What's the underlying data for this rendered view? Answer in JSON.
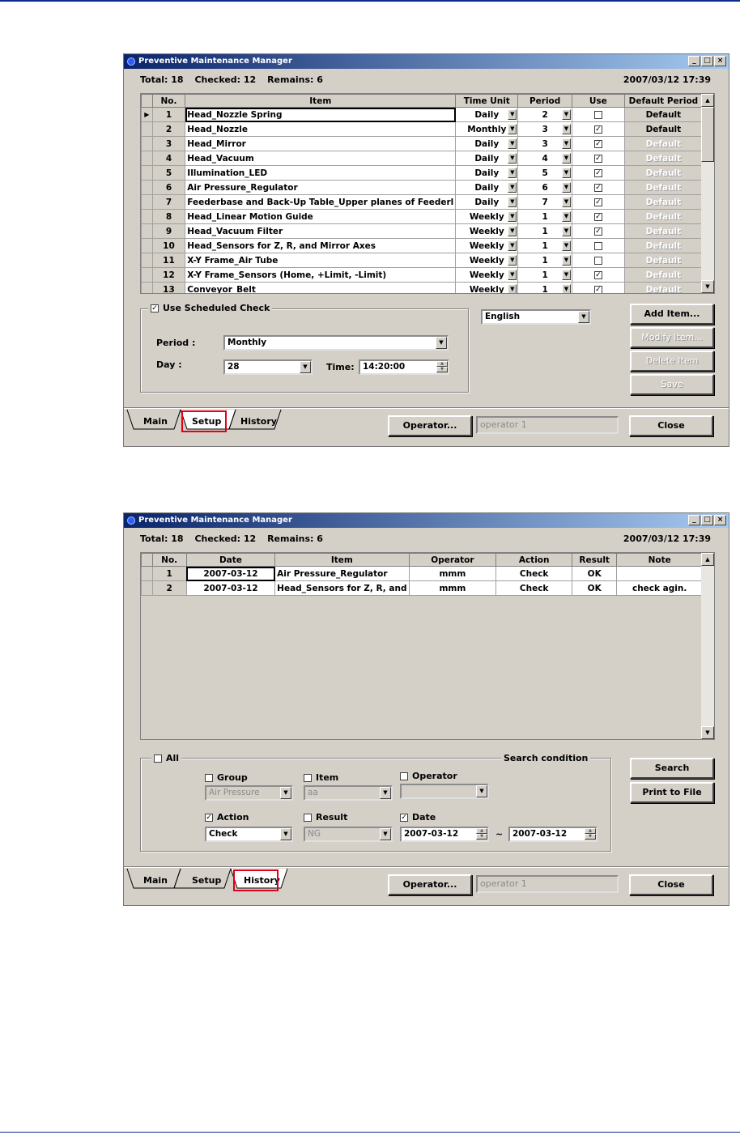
{
  "app_title": "Preventive Maintenance Manager",
  "status": {
    "total": "Total: 18",
    "checked": "Checked: 12",
    "remains": "Remains: 6",
    "datetime": "2007/03/12 17:39"
  },
  "tabs": [
    "Main",
    "Setup",
    "History"
  ],
  "operator_button": "Operator...",
  "operator_value": "operator 1",
  "close_button": "Close",
  "setup": {
    "columns": [
      "No.",
      "Item",
      "Time Unit",
      "Period",
      "Use",
      "Default Period"
    ],
    "rows": [
      {
        "no": "1",
        "item": "Head_Nozzle Spring",
        "unit": "Daily",
        "period": "2",
        "use": false,
        "def": "Default",
        "def_enabled": true,
        "selected": true
      },
      {
        "no": "2",
        "item": "Head_Nozzle",
        "unit": "Monthly",
        "period": "3",
        "use": true,
        "def": "Default",
        "def_enabled": true
      },
      {
        "no": "3",
        "item": "Head_Mirror",
        "unit": "Daily",
        "period": "3",
        "use": true,
        "def": "Default",
        "def_enabled": false
      },
      {
        "no": "4",
        "item": "Head_Vacuum",
        "unit": "Daily",
        "period": "4",
        "use": true,
        "def": "Default",
        "def_enabled": false
      },
      {
        "no": "5",
        "item": "Illumination_LED",
        "unit": "Daily",
        "period": "5",
        "use": true,
        "def": "Default",
        "def_enabled": false
      },
      {
        "no": "6",
        "item": "Air Pressure_Regulator",
        "unit": "Daily",
        "period": "6",
        "use": true,
        "def": "Default",
        "def_enabled": false
      },
      {
        "no": "7",
        "item": "Feederbase and Back-Up Table_Upper planes of Feederl",
        "unit": "Daily",
        "period": "7",
        "use": true,
        "def": "Default",
        "def_enabled": false
      },
      {
        "no": "8",
        "item": "Head_Linear Motion Guide",
        "unit": "Weekly",
        "period": "1",
        "use": true,
        "def": "Default",
        "def_enabled": false
      },
      {
        "no": "9",
        "item": "Head_Vacuum Filter",
        "unit": "Weekly",
        "period": "1",
        "use": true,
        "def": "Default",
        "def_enabled": false
      },
      {
        "no": "10",
        "item": "Head_Sensors for Z, R, and Mirror Axes",
        "unit": "Weekly",
        "period": "1",
        "use": false,
        "def": "Default",
        "def_enabled": false
      },
      {
        "no": "11",
        "item": "X-Y Frame_Air Tube",
        "unit": "Weekly",
        "period": "1",
        "use": false,
        "def": "Default",
        "def_enabled": false
      },
      {
        "no": "12",
        "item": "X-Y Frame_Sensors (Home, +Limit, -Limit)",
        "unit": "Weekly",
        "period": "1",
        "use": true,
        "def": "Default",
        "def_enabled": false
      },
      {
        "no": "13",
        "item": "Conveyor_Belt",
        "unit": "Weekly",
        "period": "1",
        "use": true,
        "def": "Default",
        "def_enabled": false
      }
    ],
    "scheduled_label": "Use Scheduled Check",
    "period_label": "Period :",
    "period_value": "Monthly",
    "day_label": "Day :",
    "day_value": "28",
    "time_label": "Time:",
    "time_value": "14:20:00",
    "language": "English",
    "buttons": {
      "add": "Add Item...",
      "modify": "Modify Item...",
      "delete": "Delete Item",
      "save": "Save"
    }
  },
  "history": {
    "columns": [
      "No.",
      "Date",
      "Item",
      "Operator",
      "Action",
      "Result",
      "Note"
    ],
    "rows": [
      {
        "no": "1",
        "date": "2007-03-12",
        "item": "Air Pressure_Regulator",
        "operator": "mmm",
        "action": "Check",
        "result": "OK",
        "note": ""
      },
      {
        "no": "2",
        "date": "2007-03-12",
        "item": "Head_Sensors for Z, R, and",
        "operator": "mmm",
        "action": "Check",
        "result": "OK",
        "note": "check agin."
      }
    ],
    "all_label": "All",
    "search_condition": "Search condition",
    "group_label": "Group",
    "group_value": "Air Pressure",
    "item_label": "Item",
    "item_value": "aa",
    "operator_label": "Operator",
    "action_label": "Action",
    "action_value": "Check",
    "result_label": "Result",
    "result_value": "NG",
    "date_label": "Date",
    "date_from": "2007-03-12",
    "date_sep": "~",
    "date_to": "2007-03-12",
    "search_button": "Search",
    "print_button": "Print to File"
  }
}
